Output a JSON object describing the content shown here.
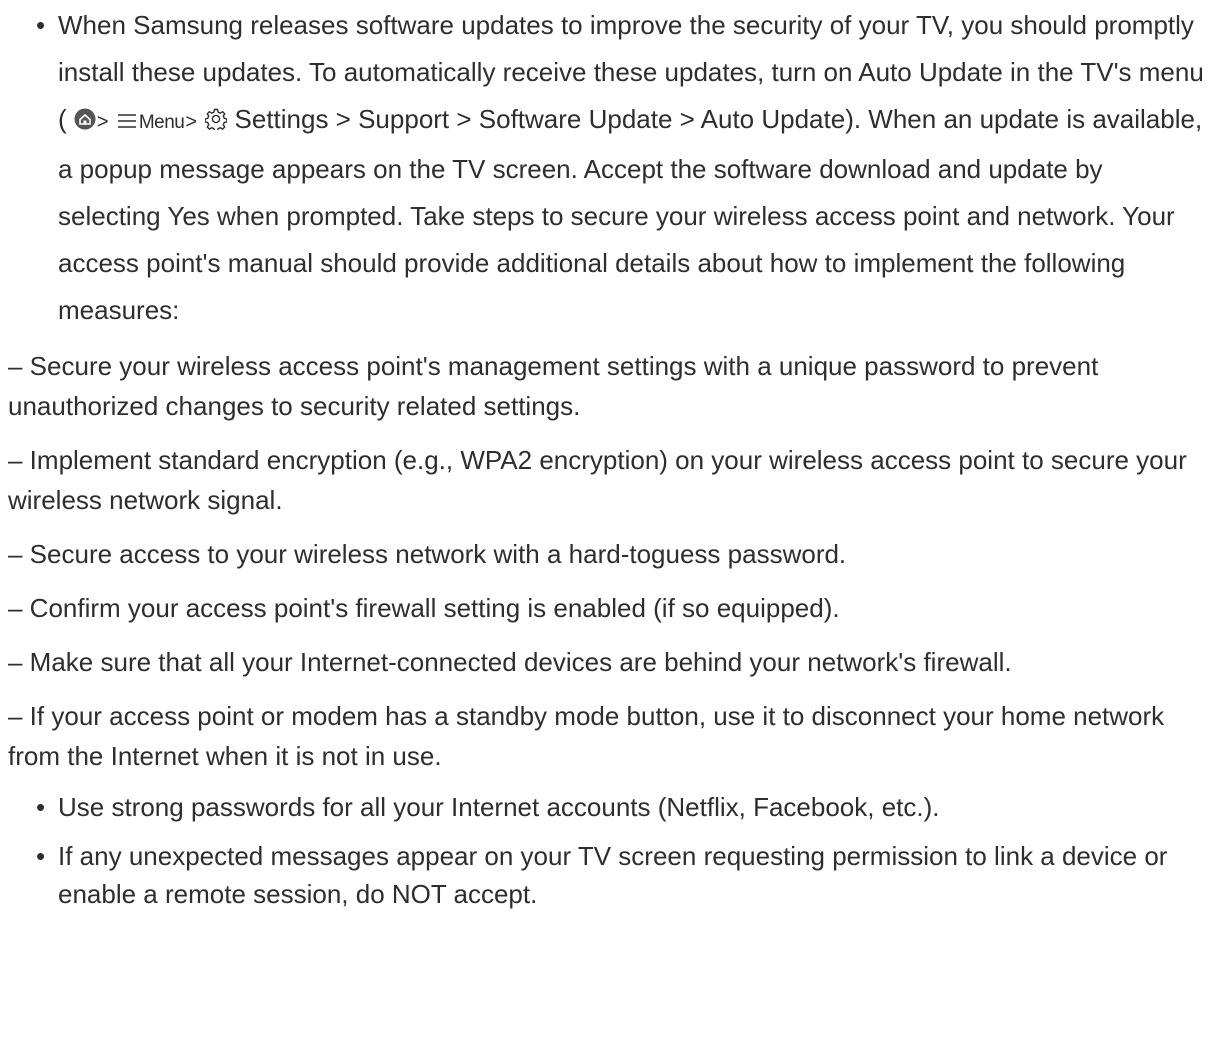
{
  "bullet_marker": "•",
  "intro": {
    "before_icons": "When Samsung releases software updates to improve the security of your TV, you should promptly install these updates. To automatically receive these updates, turn on Auto Update in the TV's menu (",
    "menu_label": "Menu",
    "separator": ">",
    "after_icons": "Settings > Support > Software Update > Auto Update). When an update is available, a popup message appears on the TV screen. Accept the software download and update by selecting Yes when prompted. Take steps to secure your wireless access point and network. Your access point's manual should provide additional details about how to implement the following measures:"
  },
  "measures": [
    "– Secure your wireless access point's management settings with a unique password to prevent unauthorized changes to security related settings.",
    "– Implement standard encryption (e.g., WPA2 encryption) on your wireless access point to secure your wireless network signal.",
    "– Secure access to your wireless network with a hard-toguess password.",
    "– Confirm your access point's firewall setting is enabled (if so equipped).",
    "– Make sure that all your Internet-connected devices are behind your network's firewall.",
    "– If your access point or modem has a standby mode button, use it to disconnect your home network from the Internet when it is not in use."
  ],
  "tips": [
    "Use strong passwords for all your Internet accounts (Netflix, Facebook, etc.).",
    "If any unexpected messages appear on your TV screen requesting permission to link a device or enable a remote session, do NOT accept."
  ],
  "icons": {
    "home": "home-icon",
    "menu": "hamburger-menu-icon",
    "settings": "settings-gear-icon"
  },
  "colors": {
    "text": "#2e2e2e",
    "icon_circle": "#555555"
  }
}
